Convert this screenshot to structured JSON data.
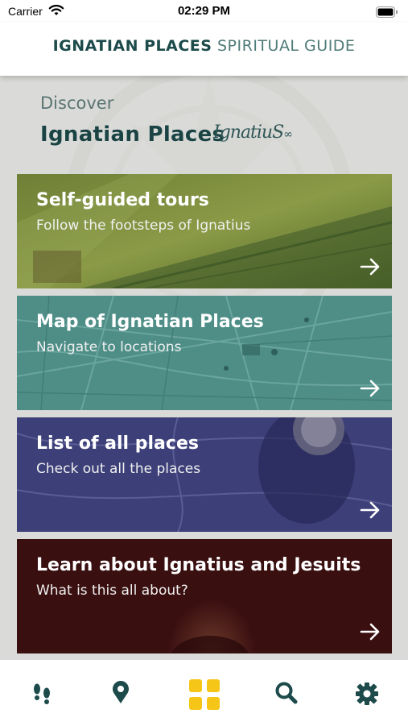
{
  "status_bar": {
    "carrier": "Carrier",
    "time": "02:29 PM"
  },
  "header": {
    "title_bold": "IGNATIAN PLACES",
    "title_light": "SPIRITUAL GUIDE"
  },
  "intro": {
    "discover": "Discover",
    "heading": "Ignatian Places",
    "logo_text": "IgnatiuS500"
  },
  "cards": [
    {
      "title": "Self-guided tours",
      "subtitle": "Follow the footsteps of Ignatius",
      "color": "#5f7a2c"
    },
    {
      "title": "Map of Ignatian Places",
      "subtitle": "Navigate to locations",
      "color": "#4e8e87"
    },
    {
      "title": "List of all places",
      "subtitle": "Check out all the places",
      "color": "#3c3f78"
    },
    {
      "title": "Learn about Ignatius and Jesuits",
      "subtitle": "What is this all about?",
      "color": "#3a0f10"
    }
  ],
  "tabbar": {
    "tabs": [
      {
        "icon": "footprints-icon",
        "active": false
      },
      {
        "icon": "map-pin-icon",
        "active": false
      },
      {
        "icon": "grid-icon",
        "active": true
      },
      {
        "icon": "search-icon",
        "active": false
      },
      {
        "icon": "gear-icon",
        "active": false
      }
    ],
    "active_color": "#f5c518",
    "inactive_color": "#1d4a4a"
  }
}
